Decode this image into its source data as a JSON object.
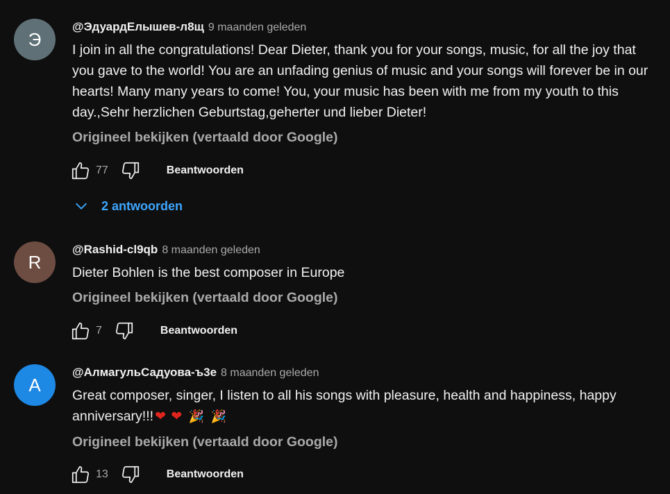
{
  "comments": [
    {
      "avatar_letter": "Э",
      "avatar_color": "#5f7177",
      "author": "@ЭдуардЕлышев-л8щ",
      "time": "9 maanden geleden",
      "text": "I join in all the congratulations! Dear Dieter, thank you for your songs, music, for all the joy that you gave to the world! You are an unfading genius of music and your songs will forever be in our hearts! Many many years to come! You, your music has been with me from my youth to this day.,Sehr herzlichen Geburtstag,geherter und lieber Dieter!",
      "translate_label": "Origineel bekijken (vertaald door Google)",
      "likes": "77",
      "reply_label": "Beantwoorden",
      "replies_label": "2 antwoorden"
    },
    {
      "avatar_letter": "R",
      "avatar_color": "#6d4c41",
      "author": "@Rashid-cl9qb",
      "time": "8 maanden geleden",
      "text": "Dieter Bohlen is the best composer in Europe",
      "translate_label": "Origineel bekijken (vertaald door Google)",
      "likes": "7",
      "reply_label": "Beantwoorden"
    },
    {
      "avatar_letter": "A",
      "avatar_color": "#1e88e5",
      "author": "@АлмагульСадуова-ъ3е",
      "time": "8 maanden geleden",
      "text": "Great composer, singer, I listen to all his songs with pleasure, health and happiness, happy anniversary!!!",
      "emoji": [
        "❤",
        "❤",
        "🎉",
        "🎉"
      ],
      "translate_label": "Origineel bekijken (vertaald door Google)",
      "likes": "13",
      "reply_label": "Beantwoorden"
    }
  ],
  "icons": {
    "like": "thumbs-up-icon",
    "dislike": "thumbs-down-icon",
    "expand": "chevron-down-icon"
  },
  "colors": {
    "background": "#0f0f0f",
    "text": "#f1f1f1",
    "muted": "#aaaaaa",
    "link": "#3ea6ff"
  }
}
